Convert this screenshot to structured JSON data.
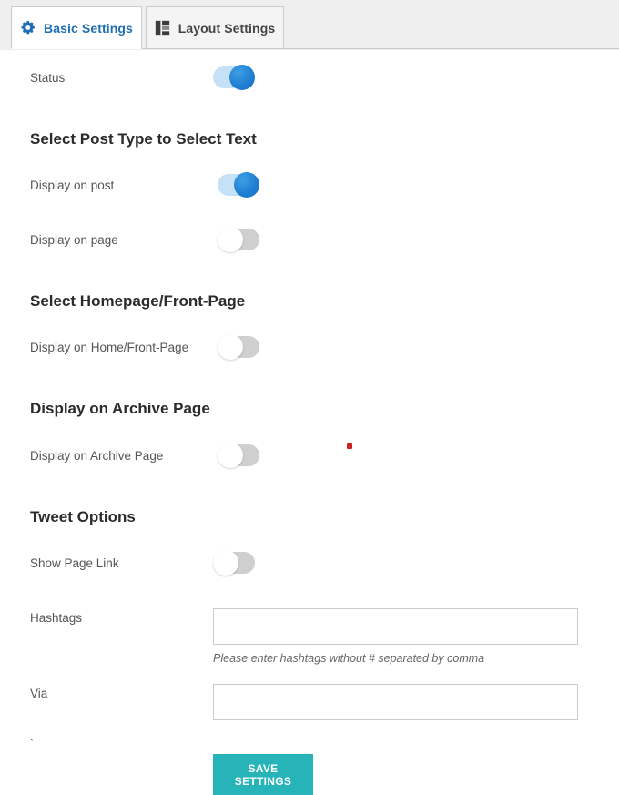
{
  "tabs": [
    {
      "id": "basic",
      "label": "Basic Settings",
      "icon": "gear-icon",
      "active": true
    },
    {
      "id": "layout",
      "label": "Layout Settings",
      "icon": "layout-grid-icon",
      "active": false
    }
  ],
  "colors": {
    "tab_active_text": "#1f6fb5",
    "toggle_on_track": "#c6e0f5",
    "toggle_on_knob": "#1f7fd4",
    "toggle_off_track": "#cfcfcf",
    "save_button": "#27b4b8",
    "marker_dot": "#cc2222",
    "page_background": "#efefef"
  },
  "settings": {
    "status": {
      "label": "Status",
      "state": "on"
    }
  },
  "sections": [
    {
      "id": "post-type",
      "title": "Select Post Type to Select Text",
      "rows": [
        {
          "id": "display-on-post",
          "label": "Display on post",
          "state": "on"
        },
        {
          "id": "display-on-page",
          "label": "Display on page",
          "state": "off"
        }
      ]
    },
    {
      "id": "homepage",
      "title": "Select Homepage/Front-Page",
      "rows": [
        {
          "id": "display-on-home",
          "label": "Display on Home/Front-Page",
          "state": "off"
        }
      ]
    },
    {
      "id": "archive",
      "title": "Display on Archive Page",
      "rows": [
        {
          "id": "display-on-archive",
          "label": "Display on Archive Page",
          "state": "off"
        }
      ]
    },
    {
      "id": "tweet-options",
      "title": "Tweet Options",
      "rows": [
        {
          "id": "show-page-link",
          "label": "Show Page Link",
          "state": "off"
        }
      ]
    }
  ],
  "fields": {
    "hashtags": {
      "label": "Hashtags",
      "value": "",
      "placeholder": "",
      "helper": "Please enter hashtags without # separated by comma"
    },
    "via": {
      "label": "Via",
      "value": "",
      "placeholder": ""
    }
  },
  "actions": {
    "save_label": "SAVE SETTINGS"
  },
  "marks": {
    "tick": "`"
  }
}
